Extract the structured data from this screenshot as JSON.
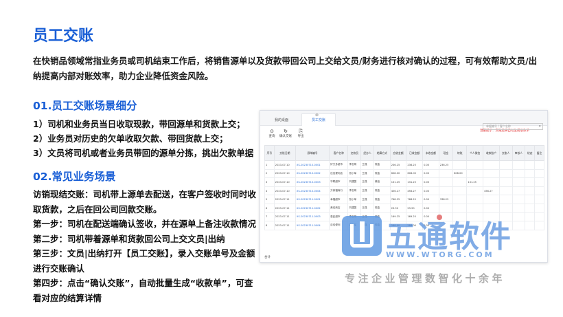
{
  "title": "员工交账",
  "intro": "在快销品领域常指业务员或司机结束工作后，将销售源单以及货款带回公司上交给文员/财务进行核对确认的过程，可有效帮助文员/出纳提高内部对账效率，助力企业降低资金风险。",
  "section1": {
    "heading": "01.员工交账场景细分",
    "items": [
      "1）司机和业务员当日收取现款，带回源单和货款上交；",
      "2）业务员对历史的欠单收取欠款、带回货款上交；",
      "3）文员将司机或者业务员带回的源单分拣，挑出欠款单据"
    ]
  },
  "section2": {
    "heading": "02.常见业务场景",
    "paragraphs": [
      "访销现结交账：司机带上源单去配送，在客户签收时同时收取货款，之后在回公司回款交账。",
      "第一步：司机在配送端确认签收，并在源单上备注收款情况",
      "第二步：司机带着源单和货款回公司上交文员|出纳",
      "第三步：文员|出纳打开【员工交账】，录入交账单号及金额进行交账确认",
      "第四步：点击“确认交账”，自动批量生成“收款单”，可查看对应的结算详情"
    ]
  },
  "screenshot": {
    "tabs": [
      "我的桌面",
      "员工交账"
    ],
    "toolbar": [
      "查询",
      "确认交账",
      "导出"
    ],
    "hint": "温馨提示：交账后将自动生成收款单",
    "search_placeholder": "单据编号 / 客户名称",
    "columns": [
      "序号",
      "交账日期",
      "源单编号",
      "客户名称",
      "交款员",
      "经办人",
      "结算方式",
      "应收金额",
      "已收金额",
      "未收金额",
      "现金",
      "转账",
      "个人微信",
      "收款账户",
      "交账人",
      "审核人",
      "状态",
      "备注"
    ],
    "rows": [
      [
        "1",
        "2023-07-10",
        "XS-20230710-0001",
        "好又多超市",
        "李志明",
        "王强",
        "现金",
        "236.25",
        "236.25",
        "0.00",
        "236.25",
        "",
        "",
        "",
        "",
        "",
        "",
        ""
      ],
      [
        "2",
        "2023-07-10",
        "XS-20230710-0002",
        "佳佳便利店",
        "张小军",
        "王强",
        "现金",
        "608.00",
        "608.00",
        "0.00",
        "",
        "608.00",
        "",
        "",
        "",
        "",
        "",
        ""
      ],
      [
        "3",
        "2023-07-10",
        "XS-20230710-0003",
        "华联超市",
        "刘建国",
        "王强",
        "微信",
        "131.25",
        "131.25",
        "0.00",
        "",
        "",
        "131.25",
        "",
        "",
        "",
        "",
        ""
      ],
      [
        "4",
        "2023-07-10",
        "XS-20230710-0004",
        "万家福商行",
        "李志明",
        "王强",
        "现金",
        "456.27",
        "456.27",
        "0.00",
        "",
        "",
        "",
        "456.27",
        "",
        "",
        "",
        ""
      ],
      [
        "5",
        "2023-07-11",
        "XS-20230711-0001",
        "幸福超市",
        "张小军",
        "王强",
        "现金",
        "768.25",
        "768.25",
        "0.00",
        "768.25",
        "",
        "",
        "",
        "",
        "",
        "",
        ""
      ],
      [
        "6",
        "2023-07-11",
        "XS-20230711-0002",
        "美佳商店",
        "刘建国",
        "王强",
        "现金",
        "23.90",
        "23.90",
        "0.00",
        "",
        "",
        "",
        "",
        "",
        "",
        "",
        ""
      ],
      [
        "7",
        "2023-07-11",
        "XS-20230711-0003",
        "惠民超市",
        "李志明",
        "王强",
        "现金",
        "169.25",
        "169.25",
        "0.00",
        "",
        "",
        "",
        "",
        "",
        "",
        "",
        ""
      ],
      [
        "8",
        "2023-07-11",
        "XS-20230711-0004",
        "百佳便利",
        "张小军",
        "王强",
        "现金",
        "288.00",
        "288.00",
        "0.00",
        "",
        "",
        "",
        "",
        "",
        "",
        "",
        ""
      ]
    ],
    "footer": "合计"
  },
  "watermark": {
    "brand": "五通软件",
    "url": "WWW.WTORG.COM",
    "tagline": "专注企业管理数智化十余年"
  }
}
